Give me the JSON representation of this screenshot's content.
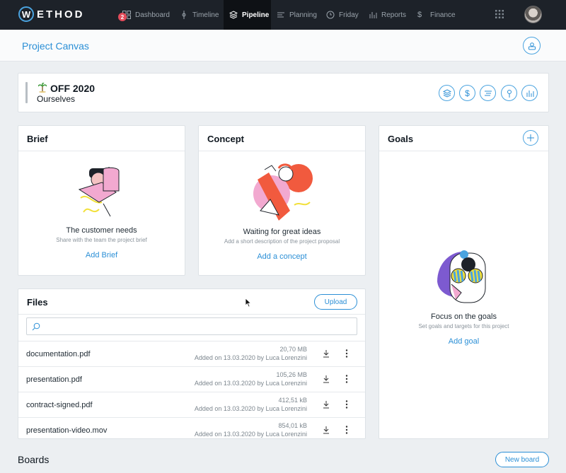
{
  "nav": {
    "logo_initial": "W",
    "logo_rest": "ETHOD",
    "notification_count": "2",
    "items": [
      {
        "label": "Dashboard",
        "icon": "dashboard-icon"
      },
      {
        "label": "Timeline",
        "icon": "timeline-icon"
      },
      {
        "label": "Pipeline",
        "icon": "layers-icon",
        "active": true
      },
      {
        "label": "Planning",
        "icon": "planning-icon"
      },
      {
        "label": "Friday",
        "icon": "clock-icon"
      },
      {
        "label": "Reports",
        "icon": "bar-chart-icon"
      },
      {
        "label": "Finance",
        "icon": "dollar-icon"
      }
    ]
  },
  "subheader": {
    "title": "Project Canvas"
  },
  "project": {
    "name": "OFF 2020",
    "client": "Ourselves"
  },
  "brief": {
    "title": "Brief",
    "caption": "The customer needs",
    "subcaption": "Share with the team the project brief",
    "action": "Add Brief"
  },
  "concept": {
    "title": "Concept",
    "caption": "Waiting for great ideas",
    "subcaption": "Add a short description of the project proposal",
    "action": "Add a concept"
  },
  "goals": {
    "title": "Goals",
    "caption": "Focus on the goals",
    "subcaption": "Set goals and targets for this project",
    "action": "Add goal"
  },
  "files": {
    "title": "Files",
    "upload_label": "Upload",
    "search_placeholder": "",
    "rows": [
      {
        "name": "documentation.pdf",
        "size": "20,70 MB",
        "added": "Added on 13.03.2020 by Luca Lorenzini"
      },
      {
        "name": "presentation.pdf",
        "size": "105,26 MB",
        "added": "Added on 13.03.2020 by Luca Lorenzini"
      },
      {
        "name": "contract-signed.pdf",
        "size": "412,51 kB",
        "added": "Added on 13.03.2020 by Luca Lorenzini"
      },
      {
        "name": "presentation-video.mov",
        "size": "854,01 kB",
        "added": "Added on 13.03.2020 by Luca Lorenzini"
      }
    ]
  },
  "boards": {
    "title": "Boards",
    "new_label": "New board"
  },
  "colors": {
    "accent": "#2b8fd6",
    "nav_bg": "#1d2229",
    "badge": "#e24b5a"
  }
}
